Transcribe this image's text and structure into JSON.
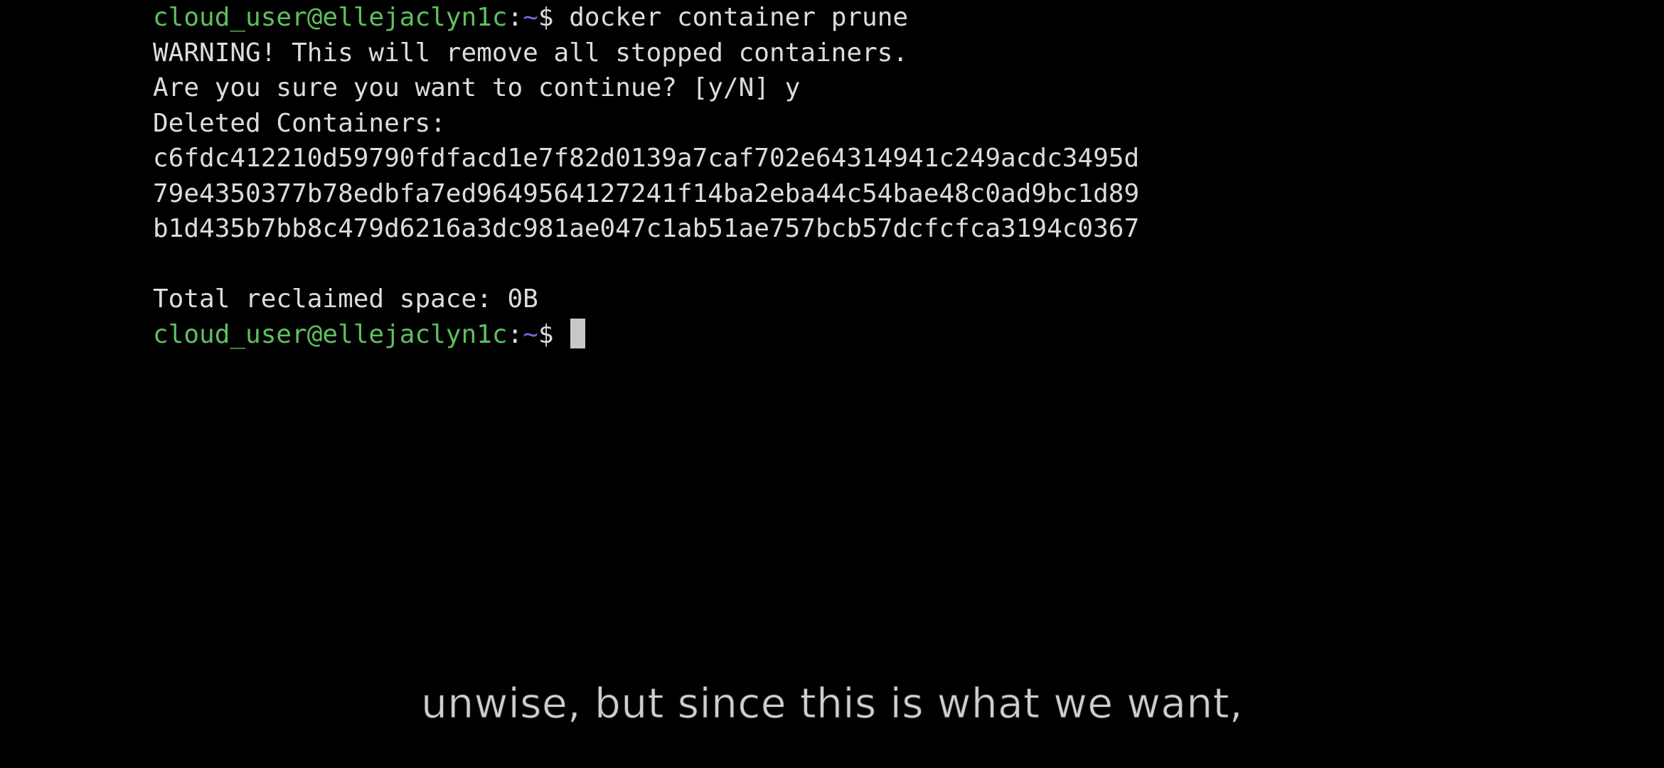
{
  "terminal": {
    "command_prompt": {
      "user_host": "cloud_user@ellejaclyn1c",
      "separator": ":",
      "path": "~",
      "dollar": "$",
      "command": " docker container prune"
    },
    "output_lines": [
      "WARNING! This will remove all stopped containers.",
      "Are you sure you want to continue? [y/N] y",
      "Deleted Containers:",
      "c6fdc412210d59790fdfacd1e7f82d0139a7caf702e64314941c249acdc3495d",
      "79e4350377b78edbfa7ed9649564127241f14ba2eba44c54bae48c0ad9bc1d89",
      "b1d435b7bb8c479d6216a3dc981ae047c1ab51ae757bcb57dcfcfca3194c0367",
      "",
      "Total reclaimed space: 0B"
    ],
    "active_prompt": {
      "user_host": "cloud_user@ellejaclyn1c",
      "separator": ":",
      "path": "~",
      "dollar": "$"
    }
  },
  "caption": {
    "text": "unwise, but since this is what we want,"
  },
  "colors": {
    "background": "#000000",
    "text": "#dcdcdc",
    "prompt_user": "#5fbf5f",
    "prompt_path": "#6e6ee6",
    "cursor": "#c8c8c8",
    "caption": "#cfcfcf"
  }
}
